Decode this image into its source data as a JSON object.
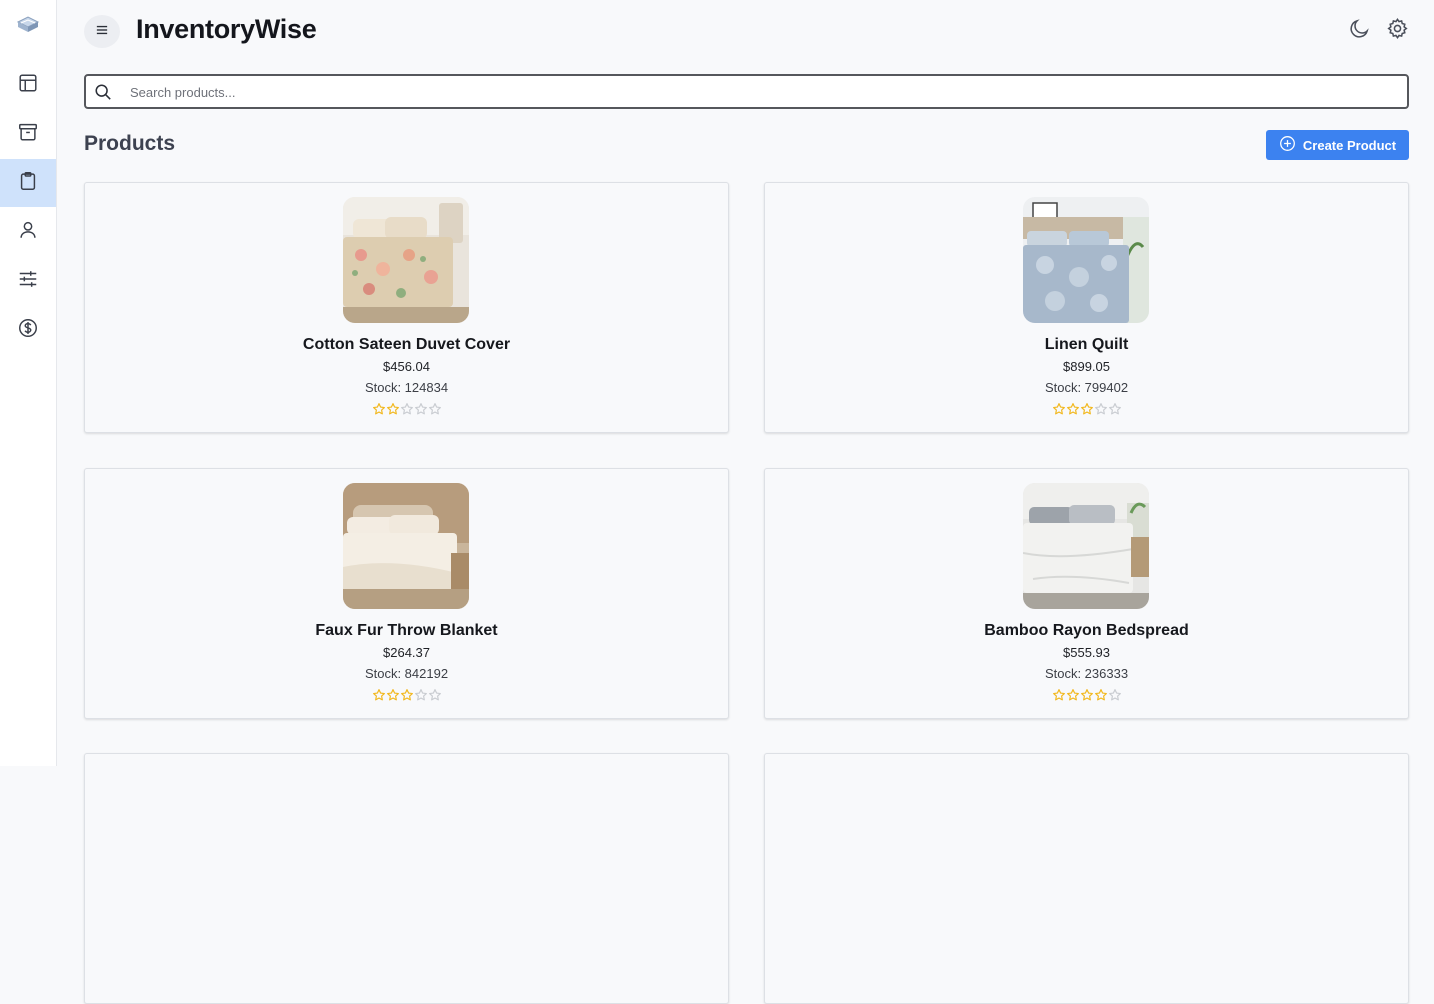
{
  "app": {
    "title": "InventoryWise"
  },
  "sidebar": {
    "items": [
      {
        "name": "dashboard",
        "icon": "layout-icon",
        "active": false
      },
      {
        "name": "archive",
        "icon": "archive-box-icon",
        "active": false
      },
      {
        "name": "products",
        "icon": "clipboard-icon",
        "active": true
      },
      {
        "name": "users",
        "icon": "user-icon",
        "active": false
      },
      {
        "name": "settings-sliders",
        "icon": "sliders-icon",
        "active": false
      },
      {
        "name": "billing",
        "icon": "dollar-icon",
        "active": false
      }
    ]
  },
  "search": {
    "placeholder": "Search products...",
    "value": ""
  },
  "page": {
    "title": "Products",
    "create_label": "Create Product"
  },
  "colors": {
    "accent": "#3c82f0",
    "star": "#f2b81e",
    "star_empty": "#c9ccd1",
    "active_nav": "#cfe2fb"
  },
  "products": [
    {
      "name": "Cotton Sateen Duvet Cover",
      "price": "$456.04",
      "stock_text": "Stock: 124834",
      "rating": 2,
      "image": "floral-bedding-photo"
    },
    {
      "name": "Linen Quilt",
      "price": "$899.05",
      "stock_text": "Stock: 799402",
      "rating": 3,
      "image": "blue-quilt-bedroom-photo"
    },
    {
      "name": "Faux Fur Throw Blanket",
      "price": "$264.37",
      "stock_text": "Stock: 842192",
      "rating": 3,
      "image": "white-bed-photo"
    },
    {
      "name": "Bamboo Rayon Bedspread",
      "price": "$555.93",
      "stock_text": "Stock: 236333",
      "rating": 4,
      "image": "grey-bedspread-photo"
    }
  ]
}
